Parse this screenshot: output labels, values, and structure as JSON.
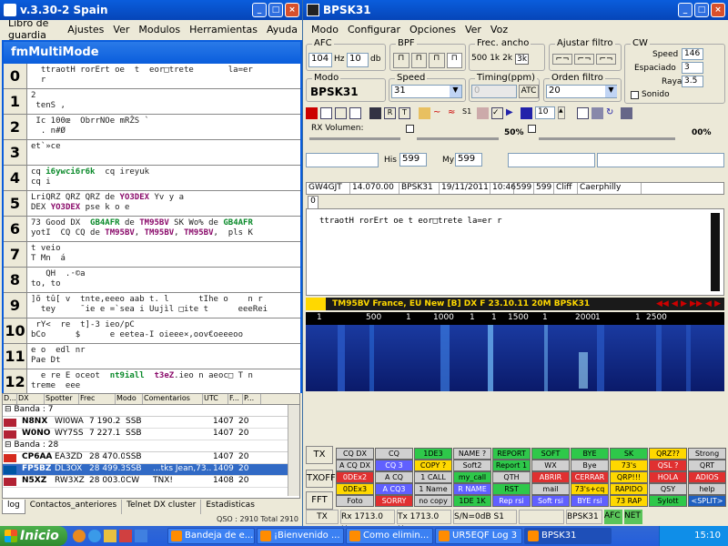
{
  "left_window": {
    "title": "v.3.30-2 Spain",
    "menu": [
      "Libro de guardia",
      "Ajustes",
      "Ver",
      "Modulos",
      "Herramientas",
      "Ayuda"
    ]
  },
  "multimode": {
    "title": "fmMultiMode",
    "rows": [
      {
        "num": "0",
        "text": "  ttraotH rorErt oe  t  eor□trete       la=er\n  r"
      },
      {
        "num": "1",
        "text": "2\n tenS ,"
      },
      {
        "num": "2",
        "text": " Ic 100œ  ObrrNOe mRŽS `\n  . n#Ø"
      },
      {
        "num": "3",
        "text": "et`»ce"
      },
      {
        "num": "4",
        "text_parts": [
          {
            "t": "cq ",
            "c": ""
          },
          {
            "t": "i6ywci6r6k",
            "c": "g"
          },
          {
            "t": "  cq ireyuk\ncq i",
            "c": ""
          }
        ]
      },
      {
        "num": "5",
        "text_parts": [
          {
            "t": "LriQRZ QRZ QRZ de ",
            "c": ""
          },
          {
            "t": "YO3DEX",
            "c": "p"
          },
          {
            "t": " Yv y a\nDEX ",
            "c": ""
          },
          {
            "t": "YO3DEX",
            "c": "p"
          },
          {
            "t": " pse k o e",
            "c": ""
          }
        ]
      },
      {
        "num": "6",
        "text_parts": [
          {
            "t": "73 Good DX  ",
            "c": ""
          },
          {
            "t": "GB4AFR",
            "c": "g"
          },
          {
            "t": " de ",
            "c": ""
          },
          {
            "t": "TM95BV",
            "c": "p"
          },
          {
            "t": " SK Wo% de ",
            "c": ""
          },
          {
            "t": "GB4AFR",
            "c": "g"
          },
          {
            "t": "\nyotI  CQ CQ de ",
            "c": ""
          },
          {
            "t": "TM95BV",
            "c": "p"
          },
          {
            "t": ", ",
            "c": ""
          },
          {
            "t": "TM95BV",
            "c": "p"
          },
          {
            "t": ", ",
            "c": ""
          },
          {
            "t": "TM95BV",
            "c": "p"
          },
          {
            "t": ",  pls K",
            "c": ""
          }
        ]
      },
      {
        "num": "7",
        "text": "t veio\nT Mn  á"
      },
      {
        "num": "8",
        "text": "   QH  .·©a\nto, to"
      },
      {
        "num": "9",
        "text": "]õ tû[ v  tnte,eeeo aab t. l      tIhe o    n r\n  tey     ¯ie e =`sea i Uujìl □ite t      eeeRei"
      },
      {
        "num": "10",
        "text": " rY<  re  t]-3 ieo/pC\nbCo      $      e eetea-I oieee×,oov€oeeeoo"
      },
      {
        "num": "11",
        "text": "e o  edl nr\nPae Dt"
      },
      {
        "num": "12",
        "text_parts": [
          {
            "t": "  e re E oceot  ",
            "c": ""
          },
          {
            "t": "nt9iall",
            "c": "g"
          },
          {
            "t": "  ",
            "c": ""
          },
          {
            "t": "t3eZ",
            "c": "p"
          },
          {
            "t": ".ieo n aeoc□ T n\ntreme  eee",
            "c": ""
          }
        ]
      }
    ]
  },
  "dx_list": {
    "headers": [
      "D...",
      "DX",
      "Spotter",
      "Frec",
      "Modo",
      "Comentarios",
      "UTC",
      "F...",
      "P..."
    ],
    "groups": [
      {
        "label": "Banda : 7",
        "rows": [
          {
            "call": "N8NX",
            "spotter": "WI0WA",
            "freq": "7 190.2",
            "mode": "SSB",
            "comment": "",
            "utc": "1407",
            "f": "20",
            "flag": "usa"
          },
          {
            "call": "W0NO",
            "spotter": "WY7SS",
            "freq": "7 227.1",
            "mode": "SSB",
            "comment": "",
            "utc": "1407",
            "f": "20",
            "flag": "usa"
          }
        ]
      },
      {
        "label": "Banda : 28",
        "rows": [
          {
            "call": "CP6AA",
            "spotter": "EA3ZD",
            "freq": "28 470.0",
            "mode": "SSB",
            "comment": "",
            "utc": "1407",
            "f": "20",
            "flag": "bol"
          },
          {
            "call": "FP5BZ",
            "spotter": "DL3OX",
            "freq": "28 499.3",
            "mode": "SSB",
            "comment": "...tks Jean,73...",
            "utc": "1409",
            "f": "20",
            "flag": "fra",
            "selected": true
          },
          {
            "call": "N5XZ",
            "spotter": "RW3XZ",
            "freq": "28 003.0",
            "mode": "CW",
            "comment": "TNX!",
            "utc": "1408",
            "f": "20",
            "flag": "usa"
          }
        ]
      }
    ],
    "tabs": [
      "log",
      "Contactos_anteriores",
      "Telnet DX cluster",
      "Estadisticas"
    ],
    "status": "QSO : 2910 Total 2910"
  },
  "bpsk": {
    "title": "BPSK31",
    "menu": [
      "Modo",
      "Configurar",
      "Opciones",
      "Ver",
      "Voz"
    ],
    "afc_label": "AFC",
    "afc_value": "104",
    "hz_label": "Hz",
    "db_value": "10",
    "db_label": "db",
    "bpf_label": "BPF",
    "frec_label": "Frec. ancho",
    "frec_opts": [
      "500",
      "1k",
      "2k",
      "3k"
    ],
    "ajustar_label": "Ajustar filtro",
    "cw_label": "CW",
    "speed_label": "Speed",
    "speed_value": "146",
    "espaciado_label": "Espaciado",
    "espaciado_value": "3",
    "raya_label": "Raya",
    "raya_value": "3.5",
    "sonido_label": "Sonido",
    "modo_label": "Modo",
    "modo_value": "BPSK31",
    "speed2_label": "Speed",
    "speed2_value": "31",
    "timing_label": "Timing(ppm)",
    "timing_value": "0",
    "atc_label": "ATC",
    "orden_label": "Orden filtro",
    "orden_value": "20",
    "toolbar_num": "10",
    "rx_volumen_label": "RX Volumen:",
    "pct1": "50%",
    "pct2": "00%",
    "his_label": "His",
    "his_value": "599",
    "my_label": "My",
    "my_value": "599",
    "qso_line": [
      "GW4GJT",
      "14.070.00",
      "BPSK31",
      "19/11/2011",
      "10:46",
      "599",
      "599",
      "Cliff",
      "Caerphilly"
    ],
    "tab0": "0",
    "rx_text": "ttraotH rorErt oe  t  eor□trete      la=er   r",
    "banner": "TM95BV France, EU New [B] DX F    23.10.11 20M BPSK31",
    "wf_marks": [
      "1",
      "500",
      "1",
      "1000",
      "1",
      "1",
      "1500",
      "1",
      "2000",
      "1",
      "1",
      "2500"
    ],
    "side_btns": [
      "TX",
      "TXOFF",
      "FFT"
    ],
    "macros": [
      [
        "CQ DX",
        "CQ",
        "1DE3",
        "NAME ?",
        "REPORT",
        "SOFT",
        "BYE",
        "SK",
        "QRZ??",
        "Strong"
      ],
      [
        "A CQ DX",
        "CQ 3",
        "COPY ?",
        "Soft2",
        "Report 1",
        "WX",
        "Bye",
        "73's",
        "QSL ?",
        "QRT"
      ],
      [
        "0DEx2",
        "A CQ",
        "1 CALL",
        "my_call",
        "QTH",
        "ABRIR",
        "CERRAR",
        "QRP!!!",
        "HOLA",
        "ADIOS"
      ],
      [
        "0DEx3",
        "A CQ3",
        "1 Name",
        "R NAME",
        "RST",
        "mail",
        "73's+cq",
        "RAPIDO",
        "QSY",
        "help"
      ],
      [
        "Foto",
        "SORRY",
        "no copy",
        "1DE 1K",
        "Rep rsi",
        "Soft rsi",
        "BYE rsi",
        "73 RAP",
        "Sylott",
        "<SPLIT>"
      ]
    ],
    "status_tx": "TX",
    "status_rx": "Rx 1713.0 Hz",
    "status_tx2": "Tx 1713.0 Hz",
    "status_sn": "S/N=0dB S1",
    "status_mode": "BPSK31",
    "status_afc": "AFC",
    "status_net": "NET"
  },
  "taskbar": {
    "start": "Inicio",
    "tasks": [
      "Bandeja de e...",
      "¡Bienvenido ...",
      "Como elimin...",
      "UR5EQF Log 3",
      "BPSK31"
    ],
    "clock": "15:10"
  },
  "colors": {
    "xp_blue": "#0a5ddc",
    "start_green": "#3c9a3c",
    "waterfall_bg": "#0a1a6a",
    "banner_bg": "#1a1a1a",
    "banner_fg": "#ffd800"
  }
}
